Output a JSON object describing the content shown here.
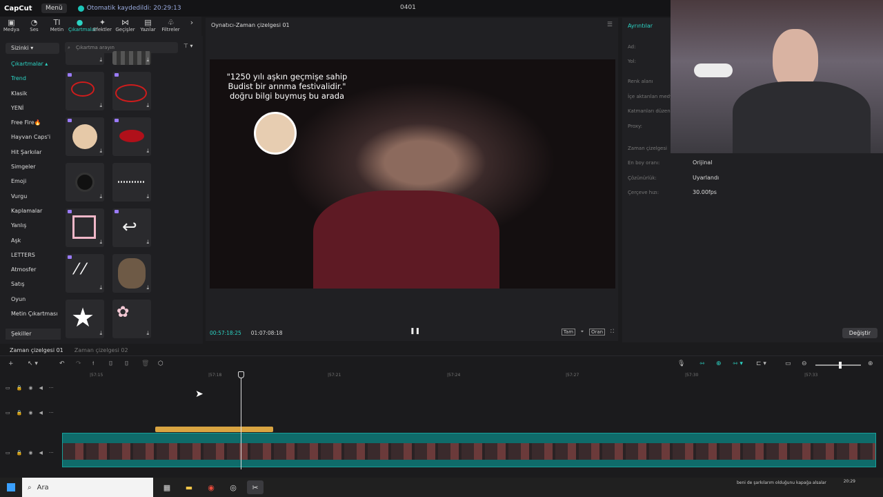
{
  "app": {
    "logo": "CapCut",
    "menu": "Menü",
    "autosave": "Otomatik kaydedildi: 20:29:13",
    "project": "0401"
  },
  "toolbar": {
    "items": [
      {
        "label": "Medya",
        "icon": "media-icon"
      },
      {
        "label": "Ses",
        "icon": "audio-icon"
      },
      {
        "label": "Metin",
        "icon": "text-icon"
      },
      {
        "label": "Çıkartmalar",
        "icon": "sticker-icon"
      },
      {
        "label": "Efektler",
        "icon": "effects-icon"
      },
      {
        "label": "Geçişler",
        "icon": "transition-icon"
      },
      {
        "label": "Yazılar",
        "icon": "captions-icon"
      },
      {
        "label": "Filtreler",
        "icon": "filter-icon"
      }
    ]
  },
  "sidebar": {
    "dropdown1": "Sizinki",
    "dropdown2": "Çıkartmalar",
    "items": [
      "Trend",
      "Klasik",
      "YENİ",
      "Free Fire🔥",
      "Hayvan Caps'i",
      "Hit Şarkılar",
      "Simgeler",
      "Emoji",
      "Vurgu",
      "Kaplamalar",
      "Yanlış",
      "Aşk",
      "LETTERS",
      "Atmosfer",
      "Satış",
      "Oyun",
      "Metin Çıkartması"
    ],
    "footer": "Şekiller"
  },
  "search": {
    "placeholder": "Çıkartma arayın"
  },
  "player": {
    "title": "Oynatıcı-Zaman çizelgesi 01",
    "caption": "\"1250 yılı aşkın geçmişe sahip Budist bir arınma festivalidir.\" doğru bilgi buymuş bu arada",
    "current_time": "00:57:18:25",
    "total_time": "01:07:08:18",
    "ctrl_full": "Tam",
    "ctrl_ratio": "Oran"
  },
  "details": {
    "title": "Ayrıntılar",
    "rows": [
      {
        "label": "Ad:",
        "value": ""
      },
      {
        "label": "Yol:",
        "value": ""
      },
      {
        "label": "Renk alanı",
        "value": ""
      },
      {
        "label": "İçe aktarılan medya",
        "value": ""
      },
      {
        "label": "Katmanları düzenle",
        "value": ""
      },
      {
        "label": "Proxy:",
        "value": ""
      },
      {
        "label": "Zaman çizelgesi",
        "value": ""
      },
      {
        "label": "En boy oranı:",
        "value": "Orijinal"
      },
      {
        "label": "Çözünürlük:",
        "value": "Uyarlandı"
      },
      {
        "label": "Çerçeve hızı:",
        "value": "30.00fps"
      }
    ],
    "button": "Değiştir"
  },
  "timeline": {
    "tabs": [
      "Zaman çizelgesi 01",
      "Zaman çizelgesi 02"
    ],
    "ruler": [
      "|57:15",
      "|57:18",
      "|57:21",
      "|57:24",
      "|57:27",
      "|57:30",
      "|57:33"
    ]
  },
  "taskbar": {
    "search": "Ara",
    "news": "beni de şarkılarım olduğunu kapağa alsalar",
    "clock": "20:29"
  },
  "colors": {
    "accent": "#2cd4c4",
    "orange_clip": "#d9a441",
    "teal_clip": "#0f6b6a"
  }
}
